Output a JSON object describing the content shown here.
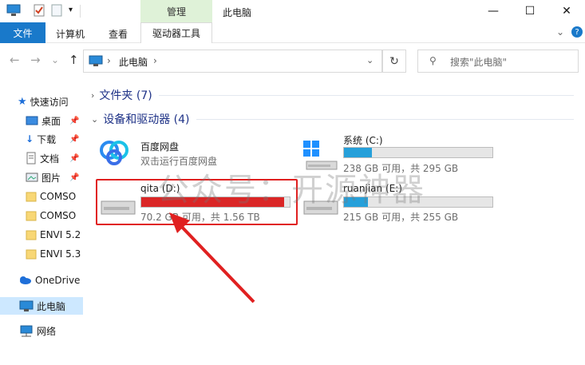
{
  "titlebar": {
    "context_tab": "管理",
    "title": "此电脑",
    "minimize": "—",
    "maximize": "☐",
    "close": "✕"
  },
  "ribbon": {
    "file": "文件",
    "computer": "计算机",
    "view": "查看",
    "drive_tools": "驱动器工具"
  },
  "nav": {
    "back": "←",
    "forward": "→",
    "recent": "⌄",
    "up": "↑",
    "address": "此电脑",
    "search_placeholder": "搜索\"此电脑\""
  },
  "sidebar": {
    "items": [
      {
        "label": "快速访问"
      },
      {
        "label": "桌面"
      },
      {
        "label": "下载"
      },
      {
        "label": "文档"
      },
      {
        "label": "图片"
      },
      {
        "label": "COMSO"
      },
      {
        "label": "COMSO"
      },
      {
        "label": "ENVI 5.2"
      },
      {
        "label": "ENVI 5.3"
      },
      {
        "label": "OneDrive"
      },
      {
        "label": "此电脑"
      },
      {
        "label": "网络"
      }
    ]
  },
  "main": {
    "folders_group": "文件夹 (7)",
    "devices_group": "设备和驱动器 (4)",
    "drives": [
      {
        "name": "百度网盘",
        "info": "双击运行百度网盘"
      },
      {
        "name": "系统 (C:)",
        "info": "238 GB 可用，共 295 GB",
        "used_fraction": 0.19
      },
      {
        "name": "qita (D:)",
        "info": "70.2 GB 可用，共 1.56 TB",
        "used_fraction": 0.96
      },
      {
        "name": "ruanjian (E:)",
        "info": "215 GB 可用，共 255 GB",
        "used_fraction": 0.16
      }
    ]
  },
  "watermark": "公众号：开源神器"
}
